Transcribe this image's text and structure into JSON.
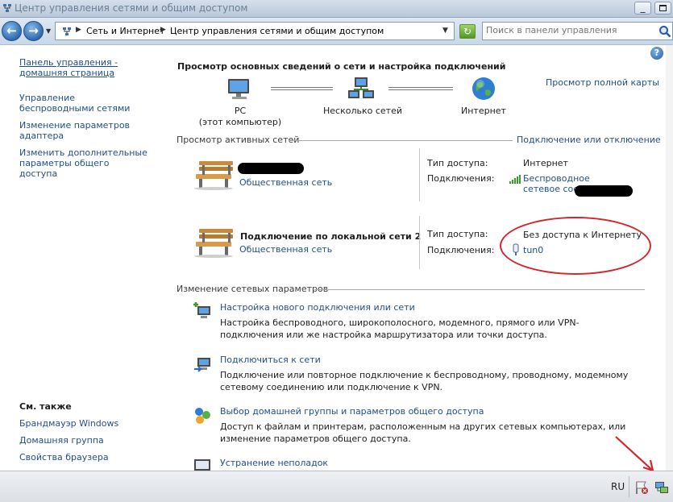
{
  "window": {
    "title": "Центр управления сетями и общим доступом",
    "minimize_glyph": "_"
  },
  "nav": {
    "breadcrumbs": [
      "Сеть и Интернет",
      "Центр управления сетями и общим доступом"
    ],
    "search_placeholder": "Поиск в панели управления"
  },
  "sidebar": {
    "home_link": "Панель управления - домашняя страница",
    "items": [
      "Управление беспроводными сетями",
      "Изменение параметров адаптера",
      "Изменить дополнительные параметры общего доступа"
    ],
    "see_also_title": "См. также",
    "see_also": [
      "Брандмауэр Windows",
      "Домашняя группа",
      "Свойства браузера"
    ]
  },
  "main": {
    "title": "Просмотр основных сведений о сети и настройка подключений",
    "full_map_link": "Просмотр полной карты",
    "map": {
      "pc_label": "PC",
      "pc_sub": "(этот компьютер)",
      "multi_label": "Несколько сетей",
      "internet_label": "Интернет"
    },
    "active_networks_label": "Просмотр активных сетей",
    "connect_disconnect_link": "Подключение или отключение",
    "networks": [
      {
        "name": "",
        "type": "Общественная сеть",
        "access_label": "Тип доступа:",
        "access_value": "Интернет",
        "connections_label": "Подключения:",
        "connection_link": "Беспроводное сетевое соединение"
      },
      {
        "name": "Подключение по локальной сети 2",
        "type": "Общественная сеть",
        "access_label": "Тип доступа:",
        "access_value": "Без доступа к Интернету",
        "connections_label": "Подключения:",
        "connection_link": "tun0"
      }
    ],
    "change_settings_label": "Изменение сетевых параметров",
    "tasks": [
      {
        "title": "Настройка нового подключения или сети",
        "desc": "Настройка беспроводного, широкополосного, модемного, прямого или VPN-подключения или же настройка маршрутизатора или точки доступа."
      },
      {
        "title": "Подключиться к сети",
        "desc": "Подключение или повторное подключение к беспроводному, проводному, модемному сетевому соединению или подключение к VPN."
      },
      {
        "title": "Выбор домашней группы и параметров общего доступа",
        "desc": "Доступ к файлам и принтерам, расположенным на других сетевых компьютерах, или изменение параметров общего доступа."
      },
      {
        "title": "Устранение неполадок",
        "desc": ""
      }
    ]
  },
  "taskbar": {
    "language": "RU"
  },
  "colors": {
    "link": "#1f4f8c",
    "annotation": "#d0262c"
  },
  "icons": [
    "back-icon",
    "forward-icon",
    "refresh-icon",
    "search-icon",
    "help-icon",
    "pc-icon",
    "network-icon",
    "globe-icon",
    "bench-icon",
    "wifi-signal-icon",
    "plug-icon",
    "flag-icon",
    "tray-network-icon"
  ]
}
